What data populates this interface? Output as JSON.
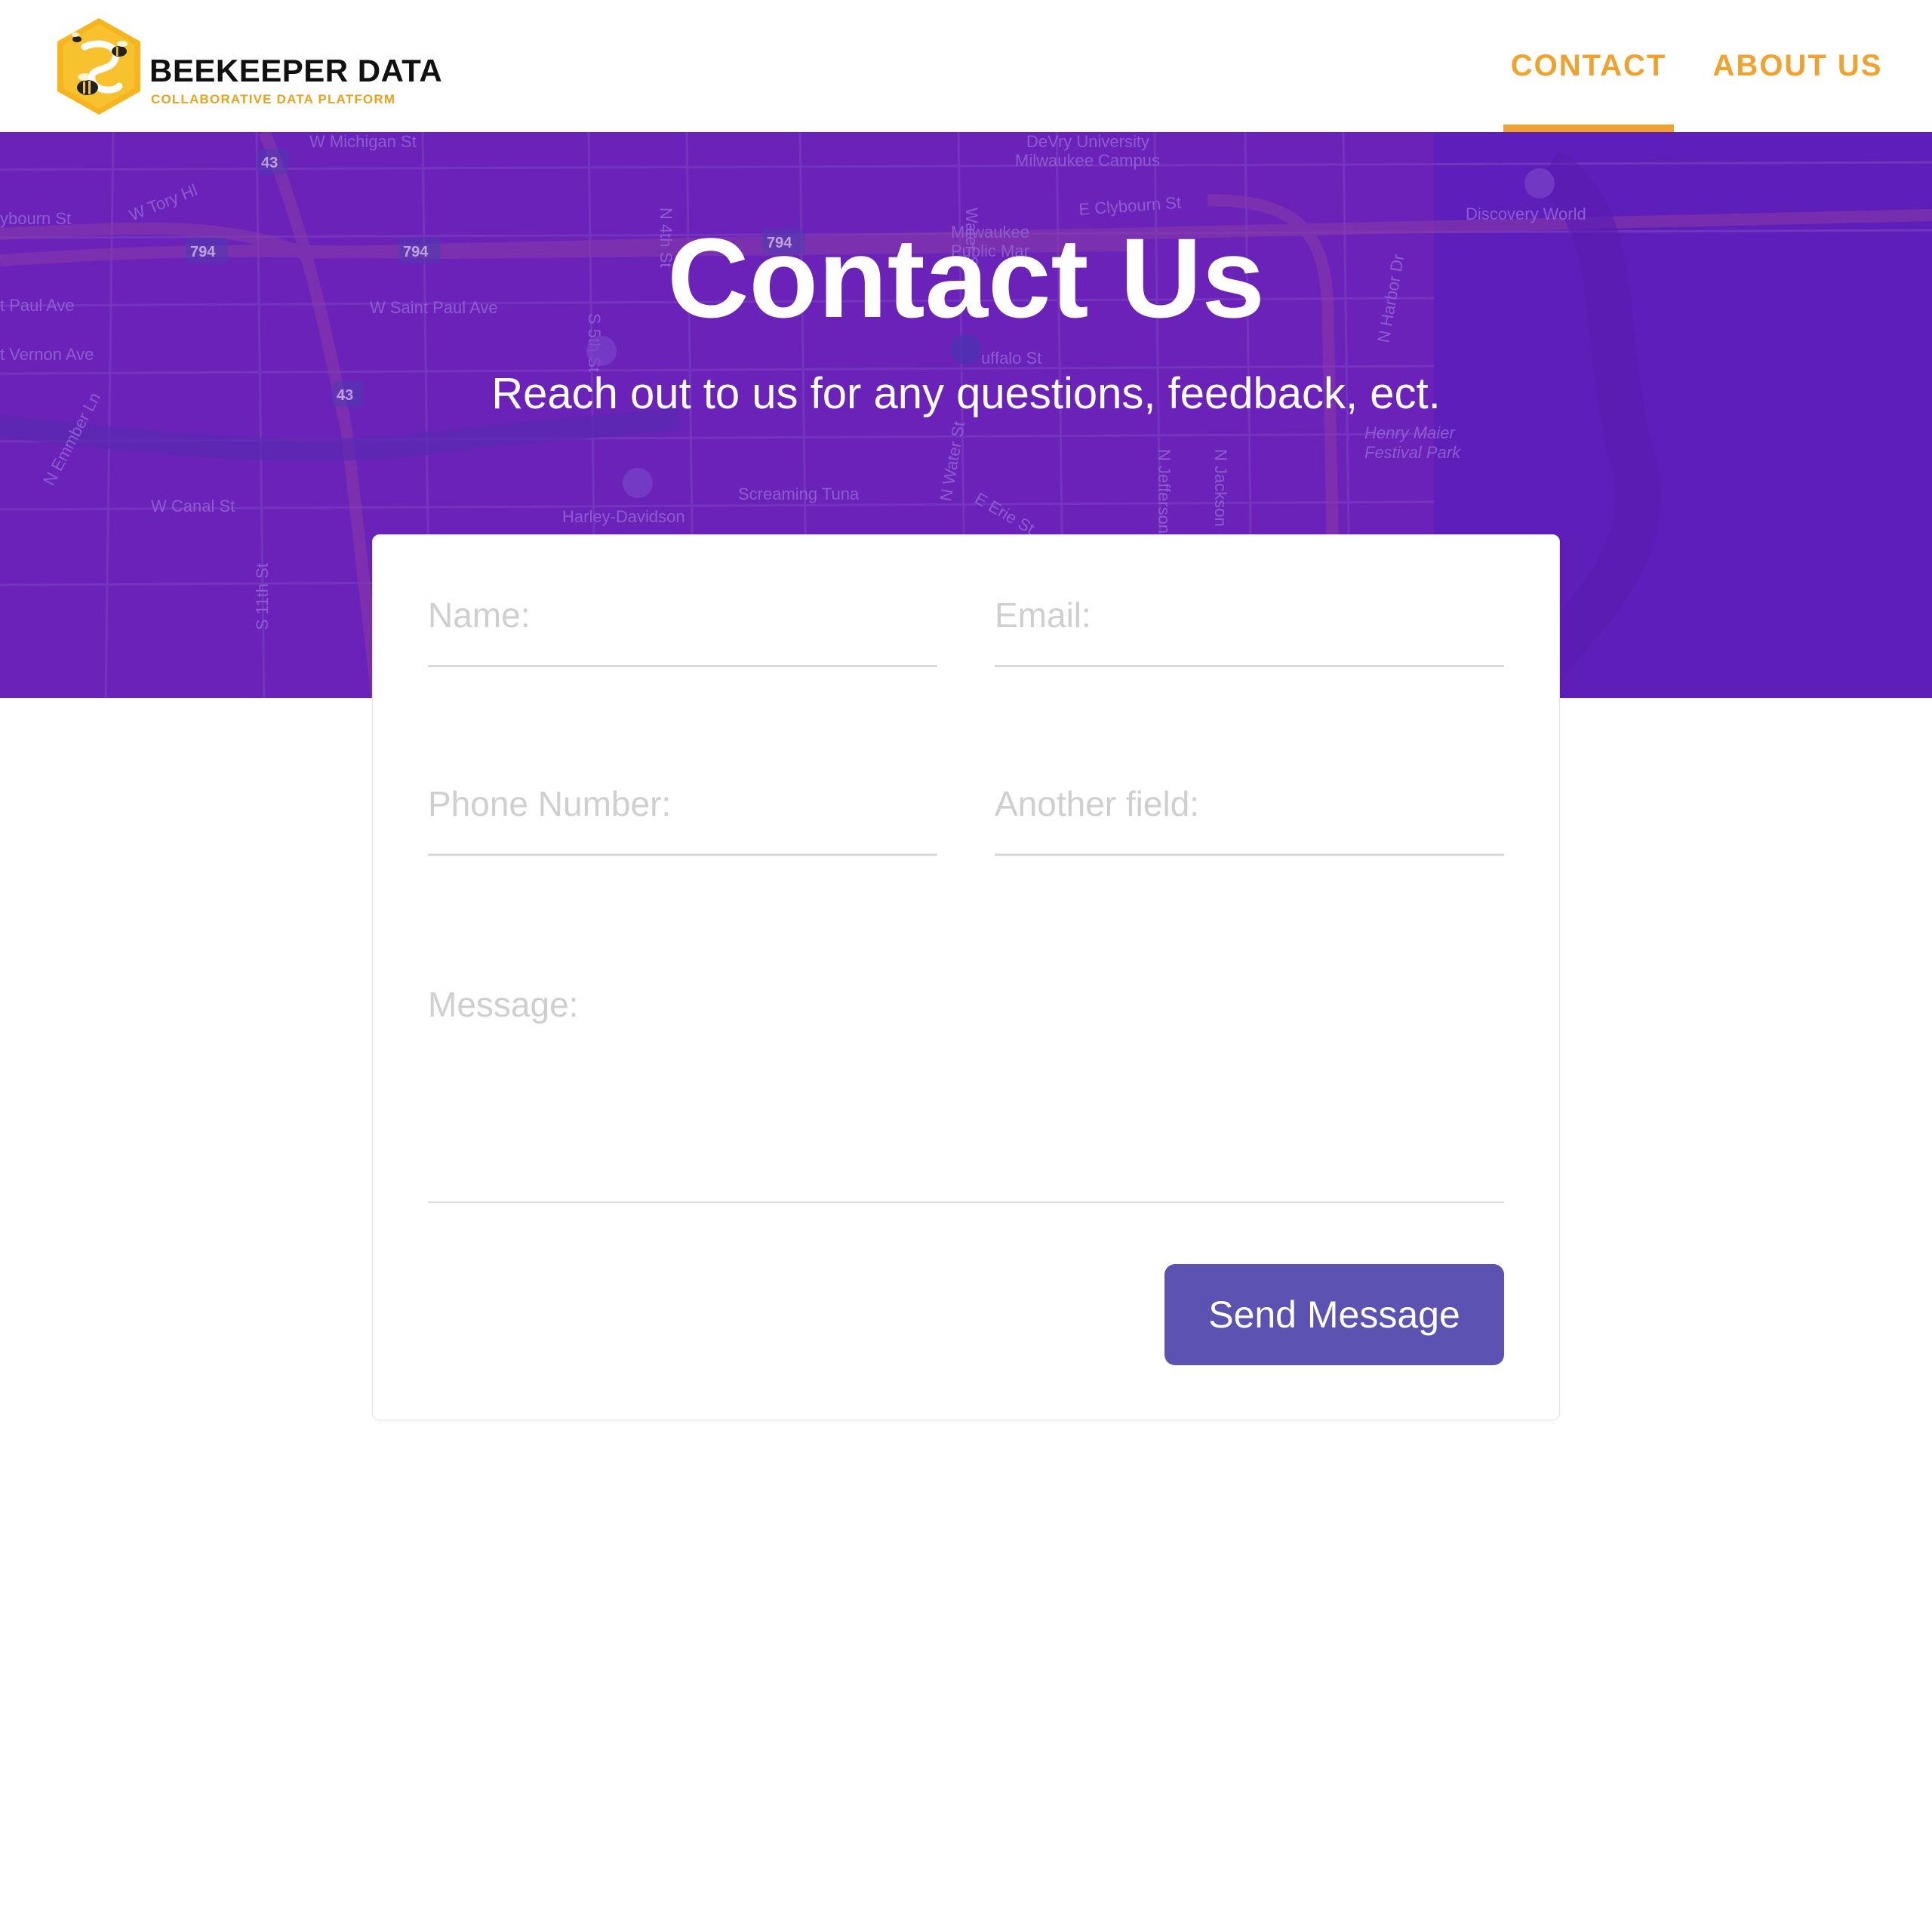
{
  "brand": {
    "name": "BEEKEEPER DATA",
    "tagline": "COLLABORATIVE DATA PLATFORM",
    "logo_icon": "bee-hexagon-icon"
  },
  "nav": {
    "items": [
      {
        "label": "CONTACT",
        "active": true
      },
      {
        "label": "ABOUT US",
        "active": false
      }
    ]
  },
  "hero": {
    "title": "Contact Us",
    "subtitle": "Reach out to us for any questions, feedback, ect.",
    "background": "map-background",
    "map_labels": {
      "tory_hl": "W Tory Hl",
      "clybourn_w": "ybourn St",
      "michigan": "W Michigan St",
      "saint_paul_w": "t Paul Ave",
      "saint_paul": "W Saint Paul Ave",
      "vernon": "t Vernon Ave",
      "emmber": "N Emmber Ln",
      "canal": "W Canal St",
      "s11th": "S 11th St",
      "n4th": "N 4th St",
      "s5th": "S 5th St",
      "water": "Water St",
      "n_water": "N Water St",
      "devry": "DeVry University",
      "devry2": "Milwaukee Campus",
      "clybourn_e": "E Clybourn St",
      "milwaukee": "Milwaukee",
      "public": "Public Mar",
      "buffalo": "uffalo St",
      "harley": "Harley-Davidson",
      "screaming": "Screaming Tuna",
      "erie": "E Erie St",
      "jefferson": "N Jefferson",
      "jackson": "N Jackson",
      "harbor": "N Harbor Dr",
      "discovery": "Discovery World",
      "henry": "Henry Maier",
      "festival": "Festival Park",
      "hwy43": "43",
      "hwy794": "794"
    }
  },
  "form": {
    "name_placeholder": "Name:",
    "email_placeholder": "Email:",
    "phone_placeholder": "Phone Number:",
    "other_placeholder": "Another field:",
    "message_placeholder": "Message:",
    "submit_label": "Send Message"
  },
  "colors": {
    "accent": "#f0a22e",
    "hero_purple": "#6322bd",
    "button": "#5b52b2"
  }
}
